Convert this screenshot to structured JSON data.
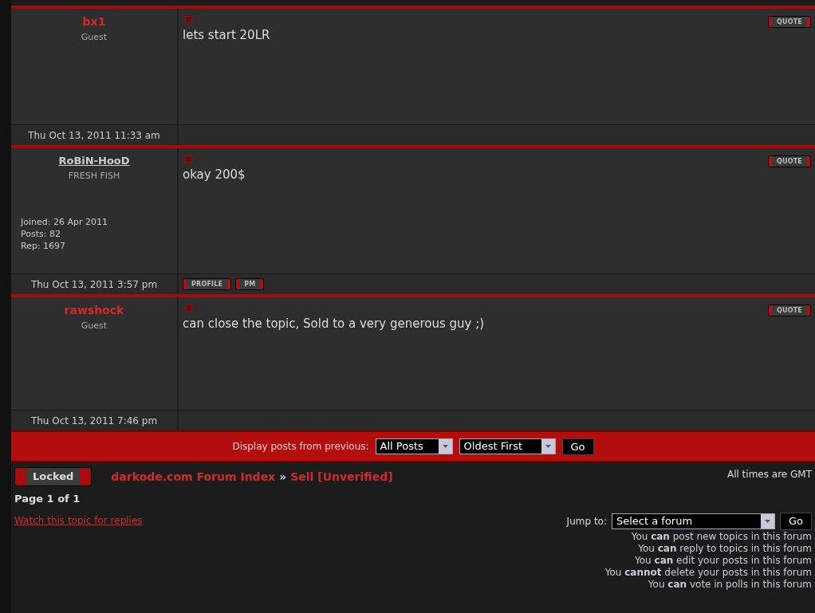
{
  "posts": [
    {
      "author": "bx1",
      "kind": "guest",
      "rank": "Guest",
      "text": "lets start 20LR",
      "quote": "QUOTE",
      "date": "Thu Oct 13, 2011 11:33 am"
    },
    {
      "author": "RoBiN-HooD",
      "kind": "member",
      "rank": "FRESH FISH",
      "stats": [
        "Joined: 26 Apr 2011",
        "Posts: 82",
        "Rep: 1697"
      ],
      "text": "okay 200$",
      "quote": "QUOTE",
      "date": "Thu Oct 13, 2011 3:57 pm",
      "buttons": [
        "PROFILE",
        "PM"
      ]
    },
    {
      "author": "rawshock",
      "kind": "guest",
      "rank": "Guest",
      "text": "can close the topic, Sold to a very generous guy ;)",
      "quote": "QUOTE",
      "date": "Thu Oct 13, 2011 7:46 pm"
    }
  ],
  "display_bar": {
    "label": "Display posts from previous:",
    "period": "All Posts",
    "order": "Oldest First",
    "go": "Go"
  },
  "locked": "Locked",
  "breadcrumb": [
    "darkode.com Forum Index",
    "»",
    "Sell [Unverified]"
  ],
  "page": "Page 1 of 1",
  "watch_link": "Watch this topic for replies",
  "timezone": "All times are GMT",
  "jump": {
    "label": "Jump to:",
    "value": "Select a forum",
    "go": "Go"
  },
  "permissions": [
    "You **can** post new topics in this forum",
    "You **can** reply to topics in this forum",
    "You **can** edit your posts in this forum",
    "You **cannot** delete your posts in this forum",
    "You **can** vote in polls in this forum"
  ]
}
